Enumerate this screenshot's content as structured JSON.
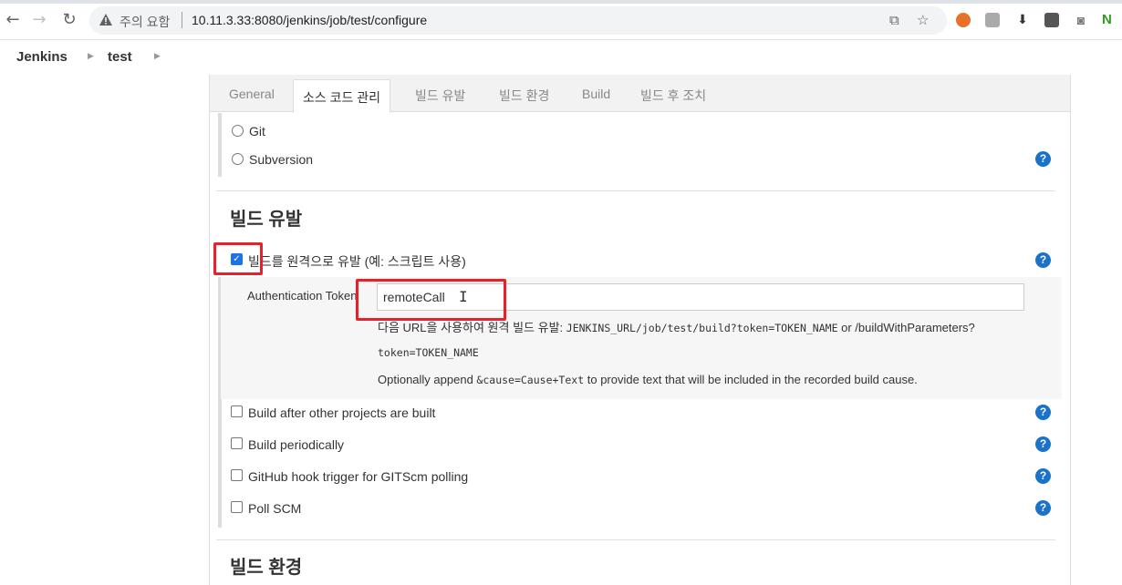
{
  "browser": {
    "security_warning": "주의 요함",
    "url": "10.11.3.33:8080/jenkins/job/test/configure"
  },
  "breadcrumbs": {
    "root": "Jenkins",
    "job": "test"
  },
  "tabs": [
    {
      "label": "General",
      "active": false
    },
    {
      "label": "소스 코드 관리",
      "active": true
    },
    {
      "label": "빌드 유발",
      "active": false
    },
    {
      "label": "빌드 환경",
      "active": false
    },
    {
      "label": "Build",
      "active": false
    },
    {
      "label": "빌드 후 조치",
      "active": false
    }
  ],
  "scm": {
    "options": [
      "Git",
      "Subversion"
    ]
  },
  "build_triggers": {
    "title": "빌드 유발",
    "remote_trigger": {
      "label": "빌드를 원격으로 유발 (예: 스크립트 사용)",
      "checked": true,
      "token_label": "Authentication Token",
      "token_value": "remoteCall",
      "hint_prefix": "다음 URL을 사용하여 원격 빌드 유발: ",
      "hint_url": "JENKINS_URL/job/test/build?token=TOKEN_NAME",
      "hint_mid": " or /buildWithParameters?",
      "hint_token": "token=TOKEN_NAME",
      "hint_append_prefix": "Optionally append ",
      "hint_append_code": "&cause=Cause+Text",
      "hint_append_suffix": " to provide text that will be included in the recorded build cause."
    },
    "options": [
      {
        "label": "Build after other projects are built",
        "checked": false
      },
      {
        "label": "Build periodically",
        "checked": false
      },
      {
        "label": "GitHub hook trigger for GITScm polling",
        "checked": false
      },
      {
        "label": "Poll SCM",
        "checked": false
      }
    ]
  },
  "build_env": {
    "title": "빌드 환경"
  },
  "icons": {
    "help": "?",
    "check": "✓"
  }
}
